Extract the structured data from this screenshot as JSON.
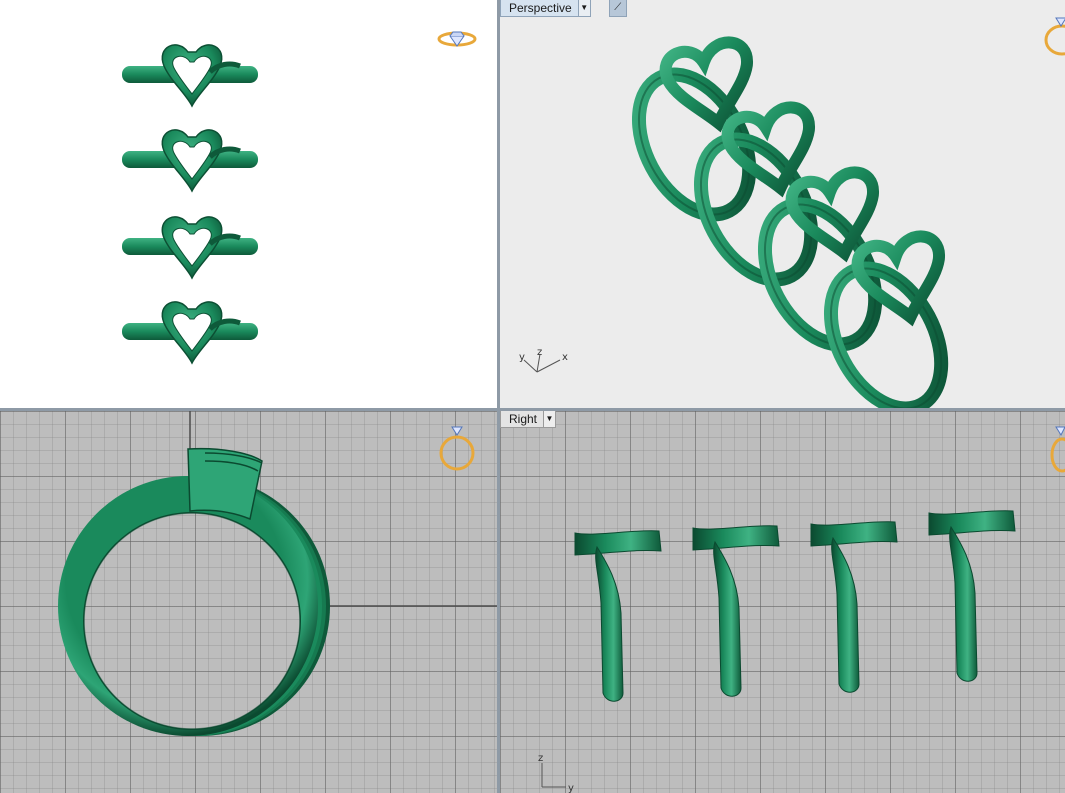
{
  "viewports": {
    "perspective": {
      "label": "Perspective",
      "dropdown_icon": "triangle-down-icon",
      "tool_icon": "magic-wand-icon",
      "axis_labels": {
        "y": "y",
        "z": "z",
        "x": "x"
      }
    },
    "right": {
      "label": "Right",
      "dropdown_icon": "triangle-down-icon",
      "axis_labels": {
        "z": "z",
        "y": "y"
      }
    }
  },
  "colors": {
    "ring_green": "#1a8a5c",
    "ring_dark": "#0e5a3a",
    "ring_light": "#3fb283",
    "widget_gold": "#e8a83a",
    "widget_blue": "#5577bb",
    "border_active": "#8fa3b8"
  }
}
